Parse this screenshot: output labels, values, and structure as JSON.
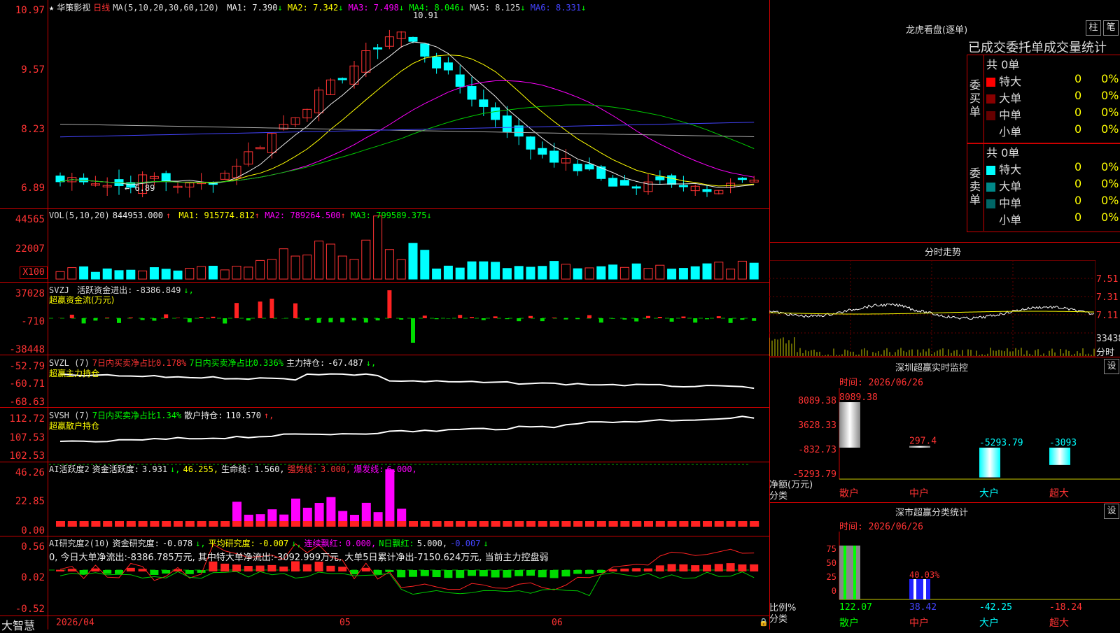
{
  "stock": {
    "star": "★",
    "name": "华策影视",
    "period": "日线"
  },
  "main": {
    "ma_label": "MA(5,10,20,30,60,120)",
    "ma": [
      {
        "label": "MA1:",
        "value": "7.390",
        "arrow": "↓",
        "color": "#eeeeee"
      },
      {
        "label": "MA2:",
        "value": "7.342",
        "arrow": "↓",
        "color": "#ffff00"
      },
      {
        "label": "MA3:",
        "value": "7.498",
        "arrow": "↓",
        "color": "#ff00ff"
      },
      {
        "label": "MA4:",
        "value": "8.046",
        "arrow": "↓",
        "color": "#00ff00"
      },
      {
        "label": "MA5:",
        "value": "8.125",
        "arrow": "↓",
        "color": "#dddddd"
      },
      {
        "label": "MA6:",
        "value": "8.331",
        "arrow": "↓",
        "color": "#4444ff"
      }
    ],
    "y_ticks": [
      "10.97",
      "9.57",
      "8.23",
      "6.89"
    ],
    "high_label": "10.91",
    "low_label": "← 6.89"
  },
  "vol": {
    "label": "VOL(5,10,20)",
    "value": "844953.000",
    "arrow": "↑",
    "ma": [
      {
        "label": "MA1:",
        "value": "915774.812",
        "arrow": "↑",
        "color": "#ffff00"
      },
      {
        "label": "MA2:",
        "value": "789264.500",
        "arrow": "↑",
        "color": "#ff00ff"
      },
      {
        "label": "MA3:",
        "value": "799589.375",
        "arrow": "↓",
        "color": "#00ff00"
      }
    ],
    "y_ticks": [
      "44565",
      "22007"
    ],
    "unit": "X100"
  },
  "svzj": {
    "name": "SVZJ",
    "label": "活跃资金进出:",
    "value": "-8386.849",
    "arrow": "↓,",
    "sub": "超赢资金流(万元)",
    "y_ticks": [
      "37028",
      "-710",
      "-38448"
    ]
  },
  "svzl": {
    "name": "SVZL (7)",
    "t1": "7日内买卖净占比0.178%",
    "t2": "7日内买卖净占比0.336%",
    "t3": "主力持仓:",
    "v3": "-67.487",
    "arrow": "↓,",
    "sub": "超赢主力持仓",
    "y_ticks": [
      "-52.79",
      "-60.71",
      "-68.63"
    ]
  },
  "svsh": {
    "name": "SVSH (7)",
    "t1": "7日内买卖净占比1.34%",
    "t2": "散户持仓:",
    "v2": "110.570",
    "arrow": "↑,",
    "sub": "超赢散户持仓",
    "y_ticks": [
      "112.72",
      "107.53",
      "102.53"
    ]
  },
  "ai1": {
    "name": "AI活跃度2",
    "t1": "资金活跃度:",
    "v1": "3.931",
    "a1": "↓,",
    "v2": "46.255,",
    "t3": "生命线:",
    "v3": "1.560,",
    "t4": "强势线:",
    "v4": "3.000,",
    "t5": "爆发线:",
    "v5": "6.000,",
    "y_ticks": [
      "46.26",
      "22.85",
      "0.00"
    ]
  },
  "ai2": {
    "name": "AI研究度2(10)",
    "t1": "资金研究度:",
    "v1": "-0.078",
    "a1": "↓,",
    "t2": "平均研究度:",
    "v2": "-0.007",
    "a2": "↓,",
    "t3": "连续飘红:",
    "v3": "0.000,",
    "t4": "N日飘红:",
    "v4": "5.000,",
    "v5": "-0.007",
    "a5": "↓",
    "desc": "0, 今日大单净流出:-8386.785万元, 其中特大单净流出:-3092.999万元, 大单5日累计净出-7150.624万元, 当前主力控盘弱",
    "y_ticks": [
      "0.56",
      "0.02",
      "-0.52"
    ]
  },
  "xaxis": {
    "brand": "大智慧",
    "labels": [
      "2026/04",
      "05",
      "06"
    ]
  },
  "lhb": {
    "title": "龙虎看盘(逐单)",
    "btn1": "柱",
    "btn2": "笔",
    "header": "已成交委托单成交量统计",
    "buy": {
      "side": "委买单",
      "total": "共 0单",
      "rows": [
        {
          "label": "特大",
          "color": "#ff0000",
          "v": "0",
          "p": "0%"
        },
        {
          "label": "大单",
          "color": "#880000",
          "v": "0",
          "p": "0%"
        },
        {
          "label": "中单",
          "color": "#660000",
          "v": "0",
          "p": "0%"
        },
        {
          "label": "小单",
          "color": "#000000",
          "v": "0",
          "p": "0%"
        }
      ]
    },
    "sell": {
      "side": "委卖单",
      "total": "共 0单",
      "rows": [
        {
          "label": "特大",
          "color": "#00ffff",
          "v": "0",
          "p": "0%"
        },
        {
          "label": "大单",
          "color": "#008888",
          "v": "0",
          "p": "0%"
        },
        {
          "label": "中单",
          "color": "#006666",
          "v": "0",
          "p": "0%"
        },
        {
          "label": "小单",
          "color": "#000000",
          "v": "0",
          "p": "0%"
        }
      ]
    }
  },
  "fenshi": {
    "title": "分时走势",
    "y_ticks": [
      "7.51",
      "7.31",
      "7.11"
    ],
    "vol": "33438",
    "unit": "分时"
  },
  "szmon": {
    "title": "深圳超赢实时监控",
    "btn": "设",
    "time": "时间: 2026/06/26",
    "y_ticks": [
      "8089.38",
      "3628.33",
      "-832.73",
      "-5293.79"
    ],
    "ylabel": "净额(万元)",
    "xlabel": "分类",
    "bars": [
      {
        "cat": "散户",
        "value": "8089.38"
      },
      {
        "cat": "中户",
        "value": "297.4"
      },
      {
        "cat": "大户",
        "value": "-5293.79"
      },
      {
        "cat": "超大",
        "value": "-3093"
      }
    ]
  },
  "szcls": {
    "title": "深市超赢分类统计",
    "btn": "设",
    "time": "时间: 2026/06/26",
    "y_ticks": [
      "75",
      "50",
      "25",
      "0"
    ],
    "ylabel": "比例%",
    "xlabel": "分类",
    "bars": [
      {
        "cat": "散户",
        "value": "122.07"
      },
      {
        "cat": "中户",
        "value": "38.42"
      },
      {
        "cat": "大户",
        "value": "-42.25"
      },
      {
        "cat": "超大",
        "value": "-18.24"
      }
    ],
    "mid": "40.03%"
  }
}
